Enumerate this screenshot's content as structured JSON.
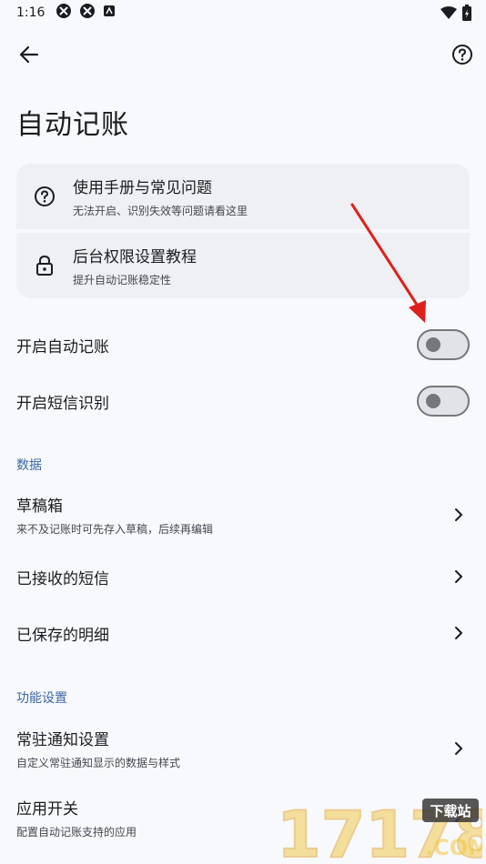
{
  "status_bar": {
    "time": "1:16"
  },
  "page": {
    "title": "自动记账"
  },
  "help": {
    "items": [
      {
        "title": "使用手册与常见问题",
        "subtitle": "无法开启、识别失效等问题请看这里"
      },
      {
        "title": "后台权限设置教程",
        "subtitle": "提升自动记账稳定性"
      }
    ]
  },
  "toggles": [
    {
      "label": "开启自动记账",
      "on": false
    },
    {
      "label": "开启短信识别",
      "on": false
    }
  ],
  "sections": {
    "data": {
      "header": "数据",
      "items": [
        {
          "title": "草稿箱",
          "subtitle": "来不及记账时可先存入草稿，后续再编辑"
        },
        {
          "title": "已接收的短信"
        },
        {
          "title": "已保存的明细"
        }
      ]
    },
    "settings": {
      "header": "功能设置",
      "items": [
        {
          "title": "常驻通知设置",
          "subtitle": "自定义常驻通知显示的数据与样式"
        },
        {
          "title": "应用开关",
          "subtitle": "配置自动记账支持的应用"
        }
      ]
    }
  },
  "watermark": {
    "numbers": "17178",
    "badge": "下载站",
    "domain": ".COM"
  },
  "colors": {
    "accent": "#3b67a8",
    "background": "#f8f9fc",
    "card": "#eef0f4",
    "annotation_arrow": "#e0201b"
  }
}
